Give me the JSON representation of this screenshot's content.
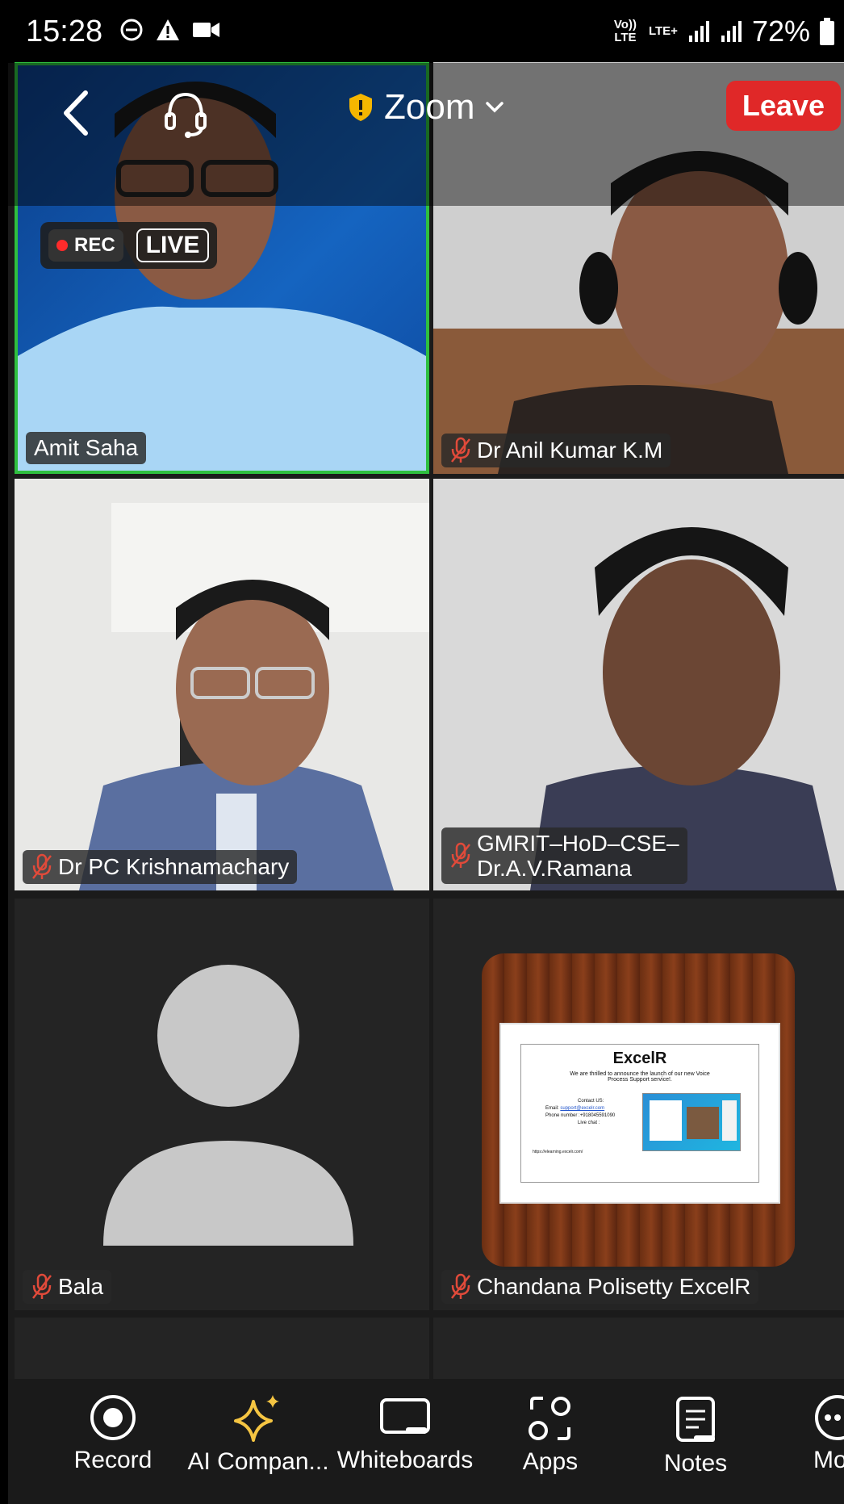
{
  "status_bar": {
    "time": "15:28",
    "volte": "Vo)) LTE",
    "lte_plus": "LTE+",
    "battery": "72%"
  },
  "meeting": {
    "title": "Zoom",
    "leave_label": "Leave",
    "rec_label": "REC",
    "live_label": "LIVE"
  },
  "participants": [
    {
      "name": "Amit Saha",
      "muted": false
    },
    {
      "name": "Dr Anil Kumar K.M",
      "muted": true
    },
    {
      "name": "Dr PC Krishnamachary",
      "muted": true
    },
    {
      "name_line1": "GMRIT–HoD–CSE–",
      "name_line2": "Dr.A.V.Ramana",
      "muted": true
    },
    {
      "name": "Bala",
      "muted": true
    },
    {
      "name": "Chandana Polisetty ExcelR",
      "muted": true
    }
  ],
  "shared_content": {
    "heading": "ExcelR",
    "line1": "We are thrilled to announce the launch of our new Voice",
    "line2": "Process Support service!.",
    "contact": "Contact US:",
    "email_label": "Email: ",
    "email": "support@excelr.com",
    "phone": "Phone number :+918045591090",
    "live_chat": "Live chat :",
    "url": "https://elearning.excelr.com/"
  },
  "toolbar": {
    "items": [
      {
        "label": "Record",
        "icon": "record-icon"
      },
      {
        "label": "AI Compan...",
        "icon": "ai-companion-icon"
      },
      {
        "label": "Whiteboards",
        "icon": "whiteboard-icon"
      },
      {
        "label": "Apps",
        "icon": "apps-icon"
      },
      {
        "label": "Notes",
        "icon": "notes-icon"
      },
      {
        "label": "Mor",
        "icon": "more-icon"
      }
    ]
  },
  "colors": {
    "active_speaker_border": "#2fbf3f",
    "leave": "#e02828",
    "ai_star": "#f5c542",
    "shield": "#f5b600",
    "mic_off": "#e04a3a"
  }
}
